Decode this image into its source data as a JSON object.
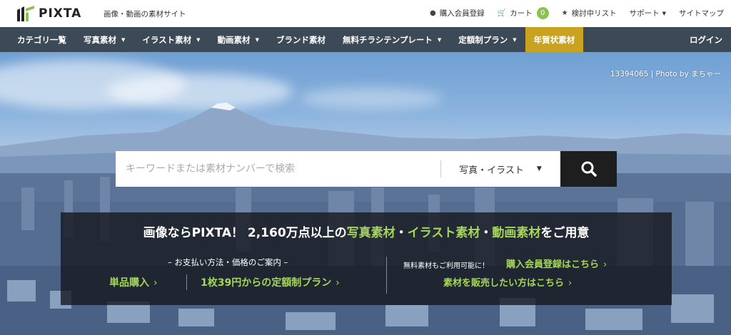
{
  "header": {
    "logo_text": "PIXTA",
    "tagline": "画像・動画の素材サイト",
    "links": {
      "register": "購入会員登録",
      "cart": "カート",
      "cart_count": "0",
      "wishlist": "検討中リスト",
      "support": "サポート",
      "sitemap": "サイトマップ"
    }
  },
  "nav": {
    "items": [
      {
        "label": "カテゴリ一覧"
      },
      {
        "label": "写真素材"
      },
      {
        "label": "イラスト素材"
      },
      {
        "label": "動画素材"
      },
      {
        "label": "ブランド素材"
      },
      {
        "label": "無料チラシテンプレート"
      },
      {
        "label": "定額制プラン"
      },
      {
        "label": "年賀状素材"
      }
    ],
    "login": "ログイン",
    "highlight_color": "#c9a21f",
    "bg_color": "#3c4a57"
  },
  "hero": {
    "photo_credit": "13394065 | Photo by まちゃー",
    "search": {
      "placeholder": "キーワードまたは素材ナンバーで検索",
      "category": "写真・イラスト"
    },
    "panel": {
      "headline_prefix": "画像ならPIXTA！ 2,160万点以上の",
      "headline_photo": "写真素材",
      "headline_dot1": "・",
      "headline_illust": "イラスト素材",
      "headline_dot2": "・",
      "headline_video": "動画素材",
      "headline_suffix": "をご用意",
      "payment_heading": "– お支払い方法・価格のご案内 –",
      "single_purchase": "単品購入",
      "plan": "1枚39円からの定額制プラン",
      "free_note": "無料素材もご利用可能に！",
      "signup": "購入会員登録はこちら",
      "sell": "素材を販売したい方はこちら",
      "accent_color": "#a5d65a"
    }
  }
}
